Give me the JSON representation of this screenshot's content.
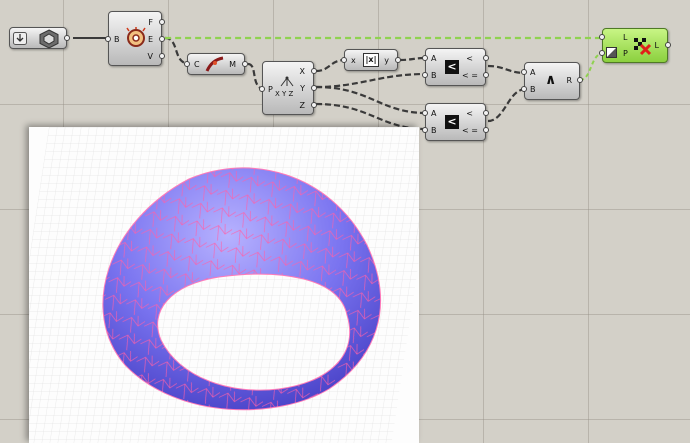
{
  "canvas": {
    "background": "#d3d0c8",
    "wire_color": "#3a3a3a",
    "preview_wire_color": "#8fd24f"
  },
  "boolean_toggle": {
    "icon": "arrow-down-icon",
    "value_icon": "hexagon-shield-icon"
  },
  "brep_component": {
    "input_labels": [
      "B"
    ],
    "output_labels": [
      "F",
      "E",
      "V"
    ],
    "icon": "brep-explode-icon"
  },
  "curve_middle": {
    "input_labels": [
      "C"
    ],
    "output_labels": [
      "M"
    ],
    "icon": "curve-icon"
  },
  "deconstruct_point": {
    "input_labels": [
      "P"
    ],
    "output_labels": [
      "X",
      "Y",
      "Z"
    ],
    "icon_text": "X Y Z"
  },
  "absolute": {
    "input_labels": [
      "x"
    ],
    "output_labels": [
      "y"
    ],
    "icon_text": "|x|"
  },
  "smaller_than_1": {
    "input_labels": [
      "A",
      "B"
    ],
    "output_labels": [
      "<",
      "< ="
    ],
    "icon_text": "<"
  },
  "smaller_than_2": {
    "input_labels": [
      "A",
      "B"
    ],
    "output_labels": [
      "<",
      "< ="
    ],
    "icon_text": "<"
  },
  "gate_and": {
    "input_labels": [
      "A",
      "B"
    ],
    "output_labels": [
      "R"
    ],
    "icon_text": "∧"
  },
  "cull_pattern": {
    "input_labels": [
      "L",
      "P"
    ],
    "output_labels": [
      "L"
    ],
    "icon": "cull-pattern-icon",
    "color": "#9ada4f"
  },
  "viewport": {
    "shape": "torus-ring",
    "surface_color": "#7a74f0",
    "wire_overlay_color": "#ff5fa8"
  }
}
